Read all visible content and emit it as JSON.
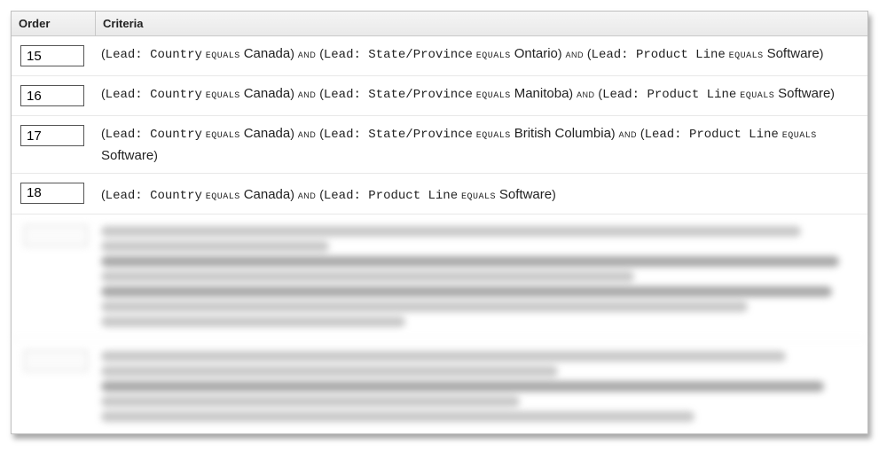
{
  "header": {
    "order": "Order",
    "criteria": "Criteria"
  },
  "equals": "equals",
  "and": "and",
  "fields": {
    "country": "Lead: Country",
    "state": "Lead: State/Province",
    "product": "Lead: Product Line"
  },
  "rows": [
    {
      "order": "15",
      "country": "Canada",
      "state": "Ontario",
      "product": "Software"
    },
    {
      "order": "16",
      "country": "Canada",
      "state": "Manitoba",
      "product": "Software"
    },
    {
      "order": "17",
      "country": "Canada",
      "state": "British Columbia",
      "product": "Software"
    },
    {
      "order": "18",
      "country": "Canada",
      "state": null,
      "product": "Software"
    }
  ]
}
